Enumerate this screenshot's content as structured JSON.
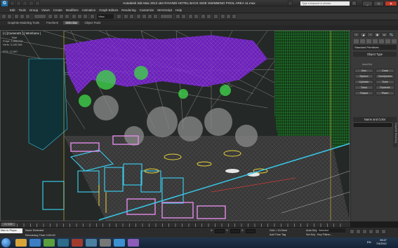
{
  "titlebar": {
    "app_badge": "G",
    "title": "Autodesk 3ds Max 2012 x64    RAVINDI HOTEL BACK SIDE SWIMMING POOL AREA 11.max",
    "search_placeholder": "Type a keyword or phrase"
  },
  "menus": [
    "Edit",
    "Tools",
    "Group",
    "Views",
    "Create",
    "Modifiers",
    "Animation",
    "Graph Editors",
    "Rendering",
    "Customize",
    "MAXScript",
    "Help"
  ],
  "toolbar": {
    "view_dropdown": "View"
  },
  "ribbon": {
    "tabs": [
      "Graphite Modeling Tools",
      "Freeform",
      "Selection",
      "Object Paint"
    ],
    "active_tab": "Selection"
  },
  "viewport": {
    "label": "[+] [Camera01 ] [ Wireframe ]",
    "stats": {
      "total_label": "Total",
      "polys_label": "Polys:",
      "polys_value": "3,286,213",
      "verts_label": "Verts:",
      "verts_value": "3,140,584",
      "fps_label": "FPS:",
      "fps_value": "12.597"
    }
  },
  "command_panel": {
    "icons": [
      "+",
      "◢",
      "◔",
      "◉",
      "▭",
      "🔧"
    ],
    "category": "Standard Primitives",
    "object_type_title": "Object Type",
    "autogrid_label": "AutoGrid",
    "buttons": [
      "Box",
      "Cone",
      "Sphere",
      "GeoSphere",
      "Cylinder",
      "Tube",
      "Torus",
      "Pyramid",
      "Teapot",
      "Plane"
    ],
    "name_color_title": "Name and Color",
    "side_tab_label": "Graphite Modeling"
  },
  "timeline": {
    "frame_label": "0 / 100"
  },
  "status": {
    "script_label": "Max to Physc",
    "line1": "None Selected",
    "line2": "Rendering Time 0:00:00",
    "grid": "Grid = 10.0mm",
    "add_time_tag": "Add Time Tag",
    "auto_key": "Auto Key",
    "selected_dropdown": "Selected",
    "set_key": "Set Key",
    "key_filters": "Key Filters..."
  },
  "taskbar": {
    "lang": "EN",
    "time": "05:47",
    "date": "7/4/2012"
  },
  "colors": {
    "accent": "#1e6fa8",
    "purple": "#7a20d8",
    "cyan": "#38c7e8",
    "green": "#3fd04a",
    "pink": "#e08ce8",
    "swatch": "#b30c3b"
  }
}
